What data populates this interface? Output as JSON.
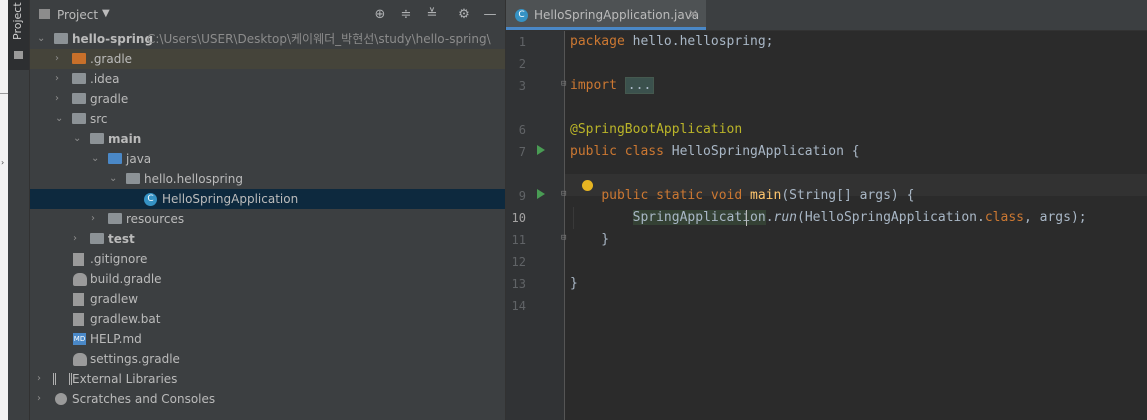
{
  "tool_window": {
    "stripe_label": "Project",
    "title": "Project",
    "dropdown_icon": "caret-down-icon",
    "header_buttons": [
      "locate-icon",
      "expand-all-icon",
      "collapse-all-icon",
      "gear-icon",
      "minimize-icon"
    ]
  },
  "tree": [
    {
      "label": "hello-spring",
      "path": "C:\\Users\\USER\\Desktop\\케이웨더_박현선\\study\\hello-spring\\",
      "icon": "module-folder-icon",
      "bold": true,
      "expanded": true
    },
    {
      "label": ".gradle",
      "icon": "folder-excluded-icon"
    },
    {
      "label": ".idea",
      "icon": "folder-icon"
    },
    {
      "label": "gradle",
      "icon": "folder-icon"
    },
    {
      "label": "src",
      "icon": "folder-icon",
      "expanded": true
    },
    {
      "label": "main",
      "icon": "folder-icon",
      "bold": true,
      "expanded": true
    },
    {
      "label": "java",
      "icon": "source-folder-icon",
      "expanded": true
    },
    {
      "label": "hello.hellospring",
      "icon": "package-icon",
      "expanded": true
    },
    {
      "label": "HelloSpringApplication",
      "icon": "spring-class-icon",
      "selected": true
    },
    {
      "label": "resources",
      "icon": "resources-folder-icon"
    },
    {
      "label": "test",
      "icon": "folder-icon",
      "bold": true
    },
    {
      "label": ".gitignore",
      "icon": "gitignore-icon"
    },
    {
      "label": "build.gradle",
      "icon": "gradle-icon"
    },
    {
      "label": "gradlew",
      "icon": "shell-icon"
    },
    {
      "label": "gradlew.bat",
      "icon": "file-icon"
    },
    {
      "label": "HELP.md",
      "icon": "markdown-icon"
    },
    {
      "label": "settings.gradle",
      "icon": "gradle-icon"
    },
    {
      "label": "External Libraries",
      "icon": "library-icon"
    },
    {
      "label": "Scratches and Consoles",
      "icon": "scratches-icon"
    }
  ],
  "editor": {
    "tab_label": "HelloSpringApplication.java",
    "tab_close": "✕",
    "line_numbers": [
      "1",
      "2",
      "3",
      "6",
      "7",
      "9",
      "10",
      "11",
      "12",
      "13",
      "14"
    ],
    "code": {
      "l1_kw": "package",
      "l1_rest": " hello.hellospring;",
      "l3_kw": "import",
      "l3_fold": "...",
      "l6_ann": "@SpringBootApplication",
      "l7_kw": "public class",
      "l7_rest": " HelloSpringApplication {",
      "l9_indent": "    ",
      "l9_kw": "public static void",
      "l9_sp": " ",
      "l9_fn": "main",
      "l9_rest": "(String[] args) {",
      "l10_indent": "        ",
      "l10_cls": "SpringApplication",
      "l10_dot": ".",
      "l10_run": "run",
      "l10_mid": "(HelloSpringApplication.",
      "l10_kw": "class",
      "l10_end": ", args);",
      "l11": "    }",
      "l13": "}"
    }
  }
}
